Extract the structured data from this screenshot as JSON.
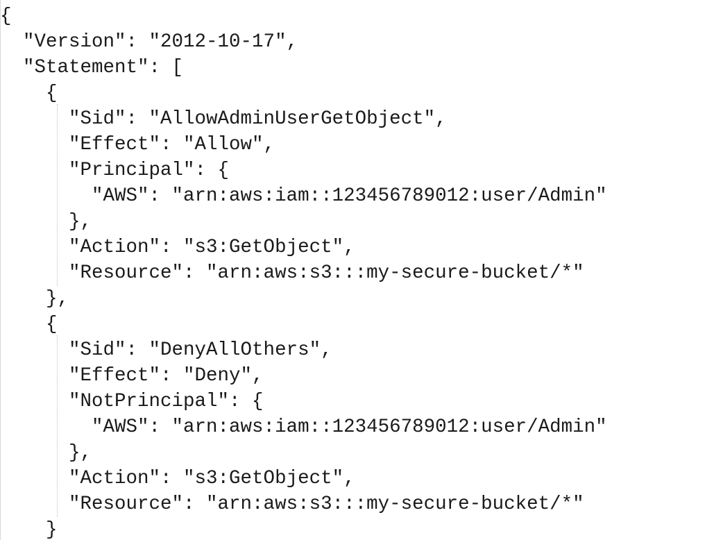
{
  "document": {
    "lines": [
      "{",
      "  \"Version\": \"2012-10-17\",",
      "  \"Statement\": [",
      "    {",
      "      \"Sid\": \"AllowAdminUserGetObject\",",
      "      \"Effect\": \"Allow\",",
      "      \"Principal\": {",
      "        \"AWS\": \"arn:aws:iam::123456789012:user/Admin\"",
      "      },",
      "      \"Action\": \"s3:GetObject\",",
      "      \"Resource\": \"arn:aws:s3:::my-secure-bucket/*\"",
      "    },",
      "    {",
      "      \"Sid\": \"DenyAllOthers\",",
      "      \"Effect\": \"Deny\",",
      "      \"NotPrincipal\": {",
      "        \"AWS\": \"arn:aws:iam::123456789012:user/Admin\"",
      "      },",
      "      \"Action\": \"s3:GetObject\",",
      "      \"Resource\": \"arn:aws:s3:::my-secure-bucket/*\"",
      "    }"
    ]
  }
}
